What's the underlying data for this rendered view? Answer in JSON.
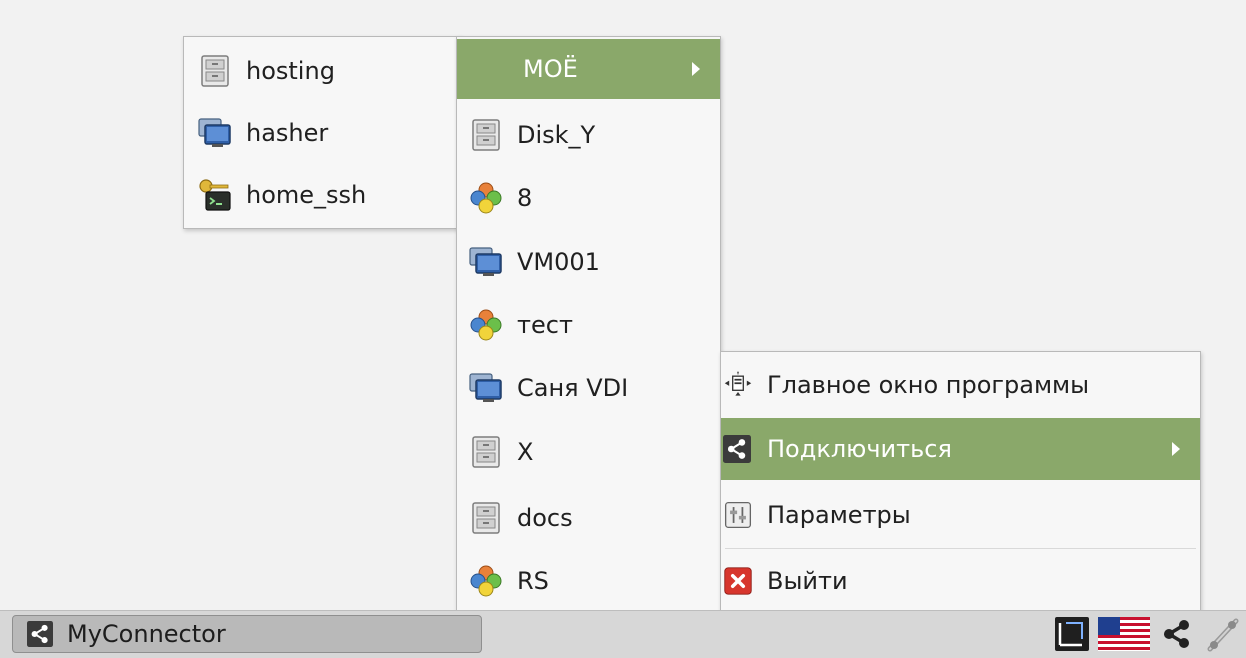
{
  "submenu_left": {
    "items": [
      {
        "label": "hosting",
        "icon": "file-cabinet-icon"
      },
      {
        "label": "hasher",
        "icon": "monitor-icon"
      },
      {
        "label": "home_ssh",
        "icon": "ssh-terminal-key-icon"
      }
    ]
  },
  "submenu_connections": {
    "header": "МОЁ",
    "items": [
      {
        "label": "Disk_Y",
        "icon": "file-cabinet-icon"
      },
      {
        "label": "8",
        "icon": "colored-circles-icon"
      },
      {
        "label": "VM001",
        "icon": "monitor-icon"
      },
      {
        "label": "тест",
        "icon": "colored-circles-icon"
      },
      {
        "label": "Саня VDI",
        "icon": "monitor-icon"
      },
      {
        "label": "X",
        "icon": "file-cabinet-icon"
      },
      {
        "label": "docs",
        "icon": "file-cabinet-icon"
      },
      {
        "label": "RS",
        "icon": "colored-circles-icon"
      }
    ]
  },
  "tray_menu": {
    "items": [
      {
        "label": "Главное окно программы",
        "icon": "main-window-icon"
      },
      {
        "label": "Подключиться",
        "icon": "share-icon"
      },
      {
        "label": "Параметры",
        "icon": "settings-icon"
      },
      {
        "label": "Выйти",
        "icon": "exit-icon"
      }
    ]
  },
  "taskbar": {
    "app_label": "MyConnector",
    "tray_icons": [
      "screenshot-icon",
      "us-flag-icon",
      "share-icon",
      "network-icon"
    ]
  },
  "colors": {
    "highlight": "#8aa86a",
    "exit_red": "#d7362d"
  }
}
